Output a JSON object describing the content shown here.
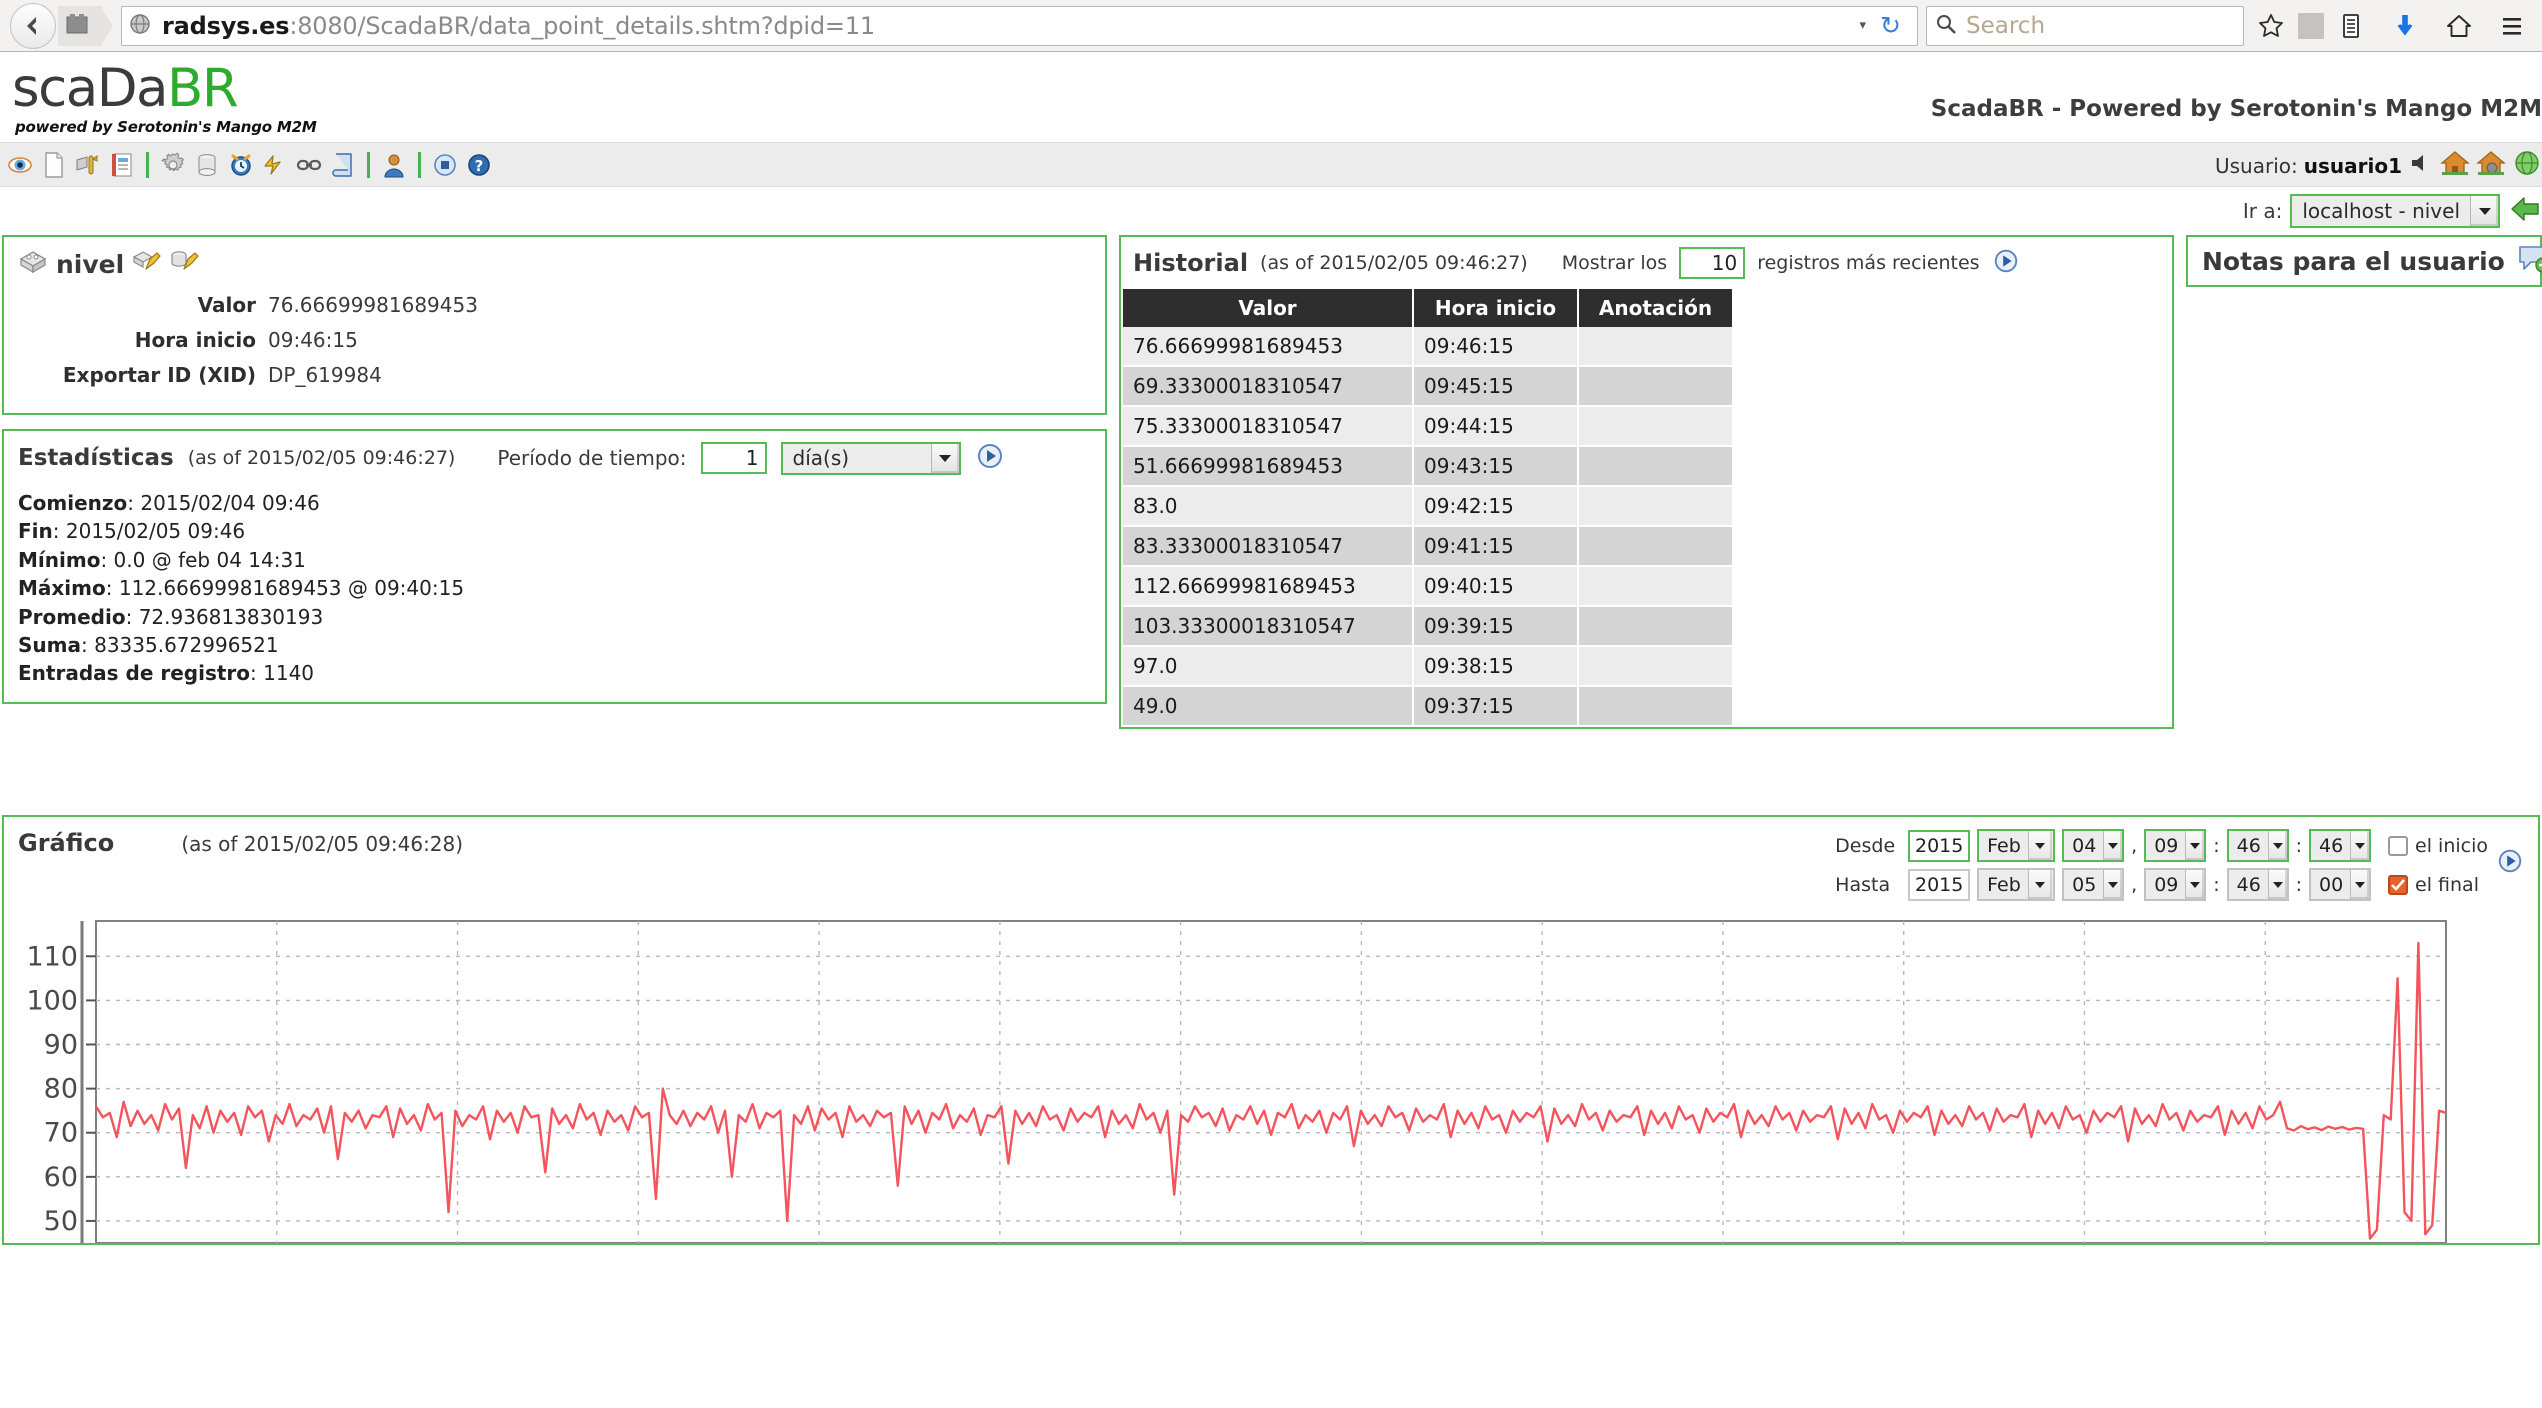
{
  "browser": {
    "url_host": "radsys.es",
    "url_rest": ":8080/ScadaBR/data_point_details.shtm?dpid=11",
    "search_placeholder": "Search",
    "back_icon": "back-arrow-icon",
    "tab_icon": "tab-icon",
    "globe_icon": "globe-icon",
    "reload_glyph": "↻",
    "dropdown_glyph": "▾",
    "bookmark_icon": "star-icon",
    "library_icon": "library-icon",
    "downloads_icon": "download-arrow-icon",
    "home_icon": "home-icon",
    "menu_icon": "hamburger-menu-icon"
  },
  "logo": {
    "part_dark": "scaDa",
    "part_green": "BR",
    "tagline": "powered by Serotonin's Mango M2M"
  },
  "header": {
    "title": "ScadaBR - Powered by Serotonin's Mango M2M",
    "user_label": "Usuario:",
    "user_name": "usuario1"
  },
  "toolbar": {
    "icons": [
      "watchlist-eye-icon",
      "new-page-icon",
      "graphical-view-icon",
      "reports-icon",
      "settings-gear-icon",
      "data-sources-icon",
      "scheduled-events-icon",
      "point-event-detectors-icon",
      "point-links-icon",
      "event-handlers-icon",
      "users-icon",
      "system-status-icon",
      "help-icon"
    ],
    "user_icons": [
      "mute-speaker-icon",
      "home-icon",
      "home-settings-icon",
      "globe-green-icon"
    ]
  },
  "goto": {
    "label": "Ir a:",
    "selected": "localhost - nivel",
    "options": [
      "localhost - nivel"
    ],
    "arrow_icon": "green-arrow-icon"
  },
  "point": {
    "icon": "data-point-icon",
    "name": "nivel",
    "edit_icons": [
      "edit-point-icon",
      "edit-properties-icon"
    ],
    "rows": [
      {
        "label": "Valor",
        "value": "76.66699981689453"
      },
      {
        "label": "Hora inicio",
        "value": "09:46:15"
      },
      {
        "label": "Exportar ID (XID)",
        "value": "DP_619984"
      }
    ]
  },
  "stats": {
    "title": "Estadísticas",
    "as_of": "(as of 2015/02/05 09:46:27)",
    "period_label": "Período de tiempo:",
    "period_value": "1",
    "period_unit": "día(s)",
    "period_unit_options": [
      "día(s)"
    ],
    "refresh_icon": "play-refresh-icon",
    "items": [
      {
        "label": "Comienzo",
        "value": "2015/02/04 09:46"
      },
      {
        "label": "Fin",
        "value": "2015/02/05 09:46"
      },
      {
        "label": "Mínimo",
        "value": "0.0 @ feb 04 14:31"
      },
      {
        "label": "Máximo",
        "value": "112.66699981689453 @ 09:40:15"
      },
      {
        "label": "Promedio",
        "value": "72.936813830193"
      },
      {
        "label": "Suma",
        "value": "83335.672996521"
      },
      {
        "label": "Entradas de registro",
        "value": "1140"
      }
    ]
  },
  "historial": {
    "title": "Historial",
    "as_of": "(as of 2015/02/05 09:46:27)",
    "show_prefix": "Mostrar los",
    "show_count": "10",
    "show_suffix": "registros más recientes",
    "refresh_icon": "play-refresh-icon",
    "columns": [
      "Valor",
      "Hora inicio",
      "Anotación"
    ],
    "rows": [
      {
        "valor": "76.66699981689453",
        "hora": "09:46:15",
        "anotacion": ""
      },
      {
        "valor": "69.33300018310547",
        "hora": "09:45:15",
        "anotacion": ""
      },
      {
        "valor": "75.33300018310547",
        "hora": "09:44:15",
        "anotacion": ""
      },
      {
        "valor": "51.66699981689453",
        "hora": "09:43:15",
        "anotacion": ""
      },
      {
        "valor": "83.0",
        "hora": "09:42:15",
        "anotacion": ""
      },
      {
        "valor": "83.33300018310547",
        "hora": "09:41:15",
        "anotacion": ""
      },
      {
        "valor": "112.66699981689453",
        "hora": "09:40:15",
        "anotacion": ""
      },
      {
        "valor": "103.33300018310547",
        "hora": "09:39:15",
        "anotacion": ""
      },
      {
        "valor": "97.0",
        "hora": "09:38:15",
        "anotacion": ""
      },
      {
        "valor": "49.0",
        "hora": "09:37:15",
        "anotacion": ""
      }
    ]
  },
  "notas": {
    "title": "Notas para el usuario",
    "icon": "comment-add-icon"
  },
  "grafico": {
    "title": "Gráfico",
    "as_of": "(as of 2015/02/05 09:46:28)",
    "refresh_icon": "play-refresh-icon",
    "desde": {
      "label": "Desde",
      "year": "2015",
      "month": "Feb",
      "day": "04",
      "hour": "09",
      "minute": "46",
      "second": "46",
      "checkbox_label": "el inicio",
      "checked": false
    },
    "hasta": {
      "label": "Hasta",
      "year": "2015",
      "month": "Feb",
      "day": "05",
      "hour": "09",
      "minute": "46",
      "second": "00",
      "checkbox_label": "el final",
      "checked": true
    },
    "sep_comma": ",",
    "sep_colon": ":"
  },
  "chart_data": {
    "type": "line",
    "title": "Gráfico",
    "xlabel": "",
    "ylabel": "",
    "ylim": [
      45,
      118
    ],
    "yticks": [
      110,
      100,
      90,
      80,
      70,
      60,
      50
    ],
    "grid": true,
    "legend_position": "none",
    "series": [
      {
        "name": "nivel",
        "color": "#f4545c",
        "values": [
          76.0,
          73.5,
          74.5,
          69.0,
          77.0,
          71.5,
          75.0,
          72.0,
          74.0,
          70.5,
          76.5,
          73.0,
          75.5,
          62.0,
          74.0,
          71.0,
          76.0,
          70.0,
          75.0,
          72.5,
          74.5,
          69.5,
          76.0,
          73.5,
          75.0,
          68.0,
          74.0,
          72.0,
          76.5,
          71.5,
          74.0,
          73.0,
          75.5,
          70.0,
          76.0,
          64.0,
          74.5,
          72.5,
          75.0,
          71.0,
          74.0,
          73.5,
          76.0,
          69.0,
          75.5,
          72.0,
          74.0,
          70.5,
          76.5,
          73.0,
          74.5,
          52.0,
          75.0,
          71.5,
          74.0,
          73.0,
          76.0,
          68.5,
          75.0,
          72.5,
          74.5,
          70.0,
          76.0,
          73.5,
          74.0,
          61.0,
          75.5,
          72.0,
          74.0,
          71.0,
          76.5,
          73.0,
          74.5,
          69.5,
          75.0,
          72.5,
          74.0,
          70.5,
          76.0,
          73.5,
          74.5,
          55.0,
          80.0,
          74.0,
          72.0,
          75.0,
          71.5,
          74.5,
          73.0,
          76.0,
          70.0,
          75.0,
          60.0,
          74.0,
          72.5,
          76.5,
          71.0,
          74.5,
          73.5,
          75.0,
          50.0,
          74.0,
          72.0,
          76.0,
          70.5,
          75.5,
          73.0,
          74.5,
          69.0,
          76.0,
          72.5,
          74.0,
          71.5,
          75.0,
          73.5,
          74.5,
          58.0,
          76.0,
          72.0,
          75.0,
          70.0,
          74.5,
          73.0,
          76.5,
          71.0,
          74.0,
          72.5,
          75.5,
          69.5,
          74.0,
          73.5,
          76.0,
          63.0,
          75.0,
          72.0,
          74.5,
          71.5,
          76.0,
          73.0,
          74.0,
          70.5,
          75.5,
          72.5,
          74.5,
          73.5,
          76.0,
          69.0,
          75.0,
          72.0,
          74.0,
          71.0,
          76.5,
          73.0,
          74.5,
          70.0,
          75.0,
          56.0,
          74.0,
          72.5,
          76.0,
          73.5,
          74.5,
          71.5,
          75.5,
          70.5,
          74.0,
          73.0,
          76.0,
          72.0,
          75.0,
          69.5,
          74.5,
          73.5,
          76.5,
          71.0,
          74.0,
          72.5,
          75.0,
          70.0,
          74.5,
          73.0,
          76.0,
          67.0,
          75.0,
          72.0,
          74.0,
          71.5,
          76.0,
          73.5,
          74.5,
          70.5,
          75.5,
          72.5,
          74.0,
          73.0,
          76.5,
          69.0,
          75.0,
          72.0,
          74.5,
          71.0,
          76.0,
          73.0,
          74.0,
          70.0,
          75.0,
          72.5,
          74.5,
          73.5,
          76.0,
          68.0,
          75.5,
          72.0,
          74.0,
          71.5,
          76.5,
          73.0,
          74.5,
          70.5,
          75.0,
          72.5,
          74.0,
          73.5,
          76.0,
          69.5,
          75.0,
          72.0,
          74.5,
          71.0,
          76.0,
          73.0,
          74.0,
          70.0,
          75.5,
          72.5,
          74.5,
          73.5,
          76.5,
          69.0,
          75.0,
          72.0,
          74.0,
          71.5,
          76.0,
          73.0,
          74.5,
          70.5,
          75.0,
          72.5,
          74.0,
          73.5,
          76.0,
          68.5,
          75.5,
          72.0,
          74.5,
          71.0,
          76.5,
          73.0,
          74.0,
          70.0,
          75.0,
          72.5,
          74.5,
          73.5,
          76.0,
          69.5,
          75.0,
          72.0,
          74.0,
          71.5,
          76.0,
          73.0,
          74.5,
          70.5,
          75.5,
          72.5,
          74.0,
          73.5,
          76.5,
          69.0,
          75.0,
          72.0,
          74.5,
          71.0,
          76.0,
          73.0,
          74.0,
          70.0,
          75.0,
          72.5,
          74.5,
          73.5,
          76.0,
          68.0,
          75.5,
          72.0,
          74.0,
          71.5,
          76.5,
          73.0,
          74.5,
          70.5,
          75.0,
          72.5,
          74.0,
          73.5,
          76.0,
          69.5,
          75.0,
          72.0,
          74.5,
          71.0,
          76.0,
          73.0,
          74.0,
          77.0,
          71.0,
          70.5,
          71.5,
          70.8,
          71.2,
          70.6,
          71.4,
          70.9,
          71.3,
          70.7,
          71.1,
          70.9,
          46.0,
          48.0,
          74.0,
          73.0,
          105.0,
          52.0,
          50.0,
          113.0,
          47.0,
          49.0,
          75.0,
          74.5
        ]
      }
    ]
  }
}
